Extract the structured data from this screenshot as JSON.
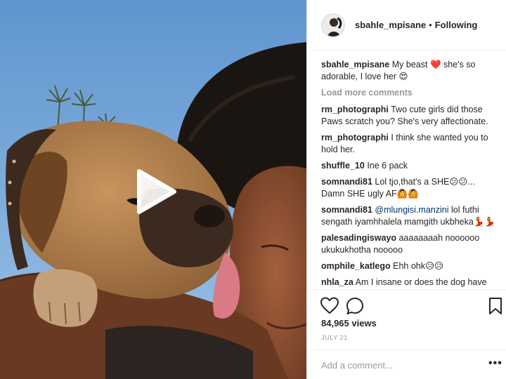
{
  "post": {
    "username": "sbahle_mpisane",
    "separator": "•",
    "follow_status": "Following",
    "caption": {
      "username": "sbahle_mpisane",
      "text_before": "My beast ",
      "emoji_1": "❤️",
      "text_after": " she's so adorable, I love her ",
      "emoji_2": "😍"
    },
    "load_more_label": "Load more comments",
    "comments": [
      {
        "username": "rm_photographi",
        "text": "Two cute girls did those Paws scratch you? She's very affectionate."
      },
      {
        "username": "rm_photographi",
        "text": "I think she wanted you to hold her."
      },
      {
        "username": "shuffle_10",
        "text": "Ine 6 pack"
      },
      {
        "username": "somnandi81",
        "text": "Lol tjo,that's a SHE😕😕... Damn SHE ugly AF🙆🙆"
      },
      {
        "username": "somnandi81",
        "mention": "@mlungisi.manzini",
        "text": " lol futhi sengath iyamhhalela mamgith ukbheka💃💃"
      },
      {
        "username": "palesadingiswayo",
        "text": "aaaaaaaah noooooo ukukukhotha nooooo"
      },
      {
        "username": "omphile_katlego",
        "text": "Ehh ohk😥😥"
      },
      {
        "username": "nhla_za",
        "text": "Am I insane or does the dog have skin😂"
      }
    ],
    "views": "84,965 views",
    "date": "JULY 21",
    "add_comment_placeholder": "Add a comment...",
    "more_options": "•••"
  },
  "icons": {
    "like": "heart-icon",
    "comment": "comment-bubble-icon",
    "save": "bookmark-icon",
    "play": "play-icon"
  },
  "colors": {
    "text": "#262626",
    "muted": "#999999",
    "mention": "#003569",
    "border": "#efefef",
    "sky": "#7aa9d8"
  }
}
